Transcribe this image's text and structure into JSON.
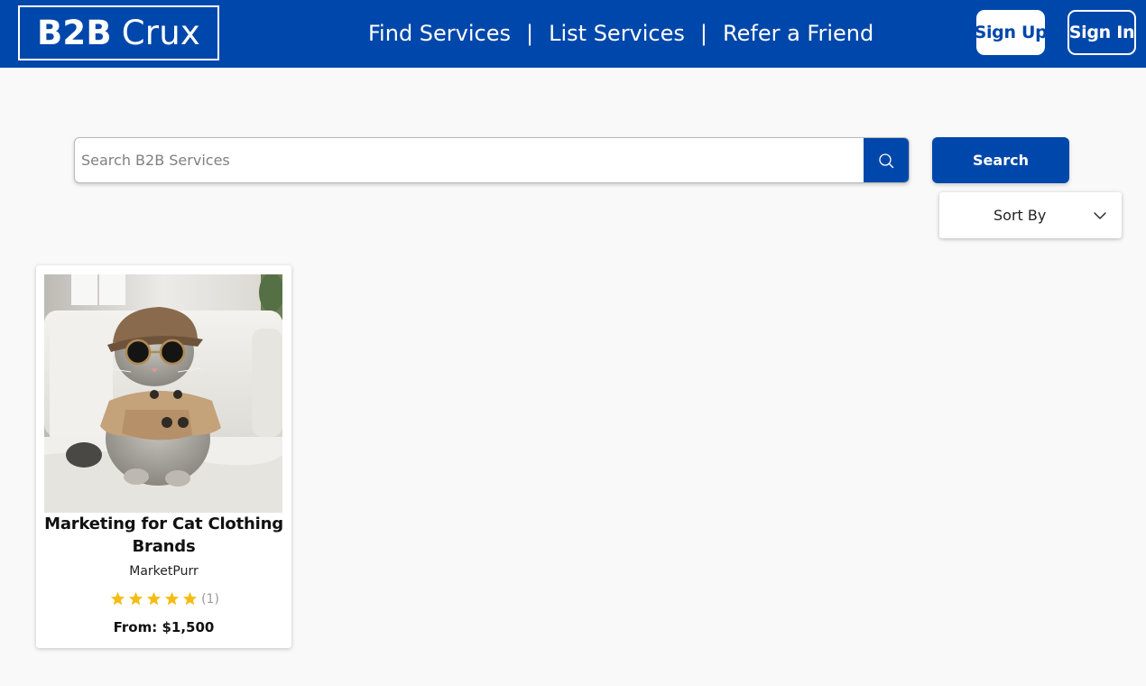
{
  "header": {
    "logo": {
      "bold": "B2B",
      "light": "Crux"
    },
    "nav": [
      {
        "label": "Find Services"
      },
      {
        "label": "List Services"
      },
      {
        "label": "Refer a Friend"
      }
    ],
    "separator": "|",
    "signup_label": "Sign Up",
    "signin_label": "Sign In"
  },
  "search": {
    "placeholder": "Search B2B Services",
    "value": "",
    "icon": "search-icon",
    "button_label": "Search"
  },
  "sort": {
    "selected": "Sort By",
    "icon": "chevron-down-icon"
  },
  "listings": [
    {
      "title": "Marketing for Cat Clothing Brands",
      "vendor": "MarketPurr",
      "rating_stars": 5,
      "rating_count": "(1)",
      "price": "From: $1,500",
      "image": "cat-in-hat-and-sunglasses-photo"
    }
  ],
  "colors": {
    "brand_blue": "#0047ab",
    "background": "#f9f9f9",
    "star": "#f5bd14",
    "muted_text": "#9a9a9a"
  }
}
